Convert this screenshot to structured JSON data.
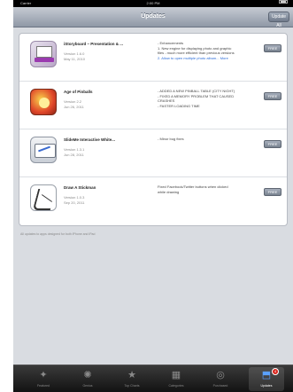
{
  "status_bar": {
    "carrier": "Carrier",
    "time": "2:00 PM",
    "battery": ""
  },
  "nav": {
    "title": "Updates",
    "right_button": "Update All"
  },
  "updates": [
    {
      "name": "iStoryboard – Presentation & ...",
      "version": "Version 1.6.0",
      "date": "May 11, 2010",
      "notes": [
        "- Enhancements",
        "1. New engine for displaying photo and graphic",
        "files - much more efficient than previous versions",
        "2. Allow to open multiple photo album...  More"
      ],
      "button": "FREE",
      "icon": "presentation-icon"
    },
    {
      "name": "Age of Pinballs",
      "version": "Version 2.2",
      "date": "Jun 26, 2011",
      "notes": [
        "- ADDED A NEW PINBALL TABLE (CITY NIGHT)",
        "- FIXED A MEMORY PROBLEM THAT CAUSED",
        "CRASHES",
        "- FASTER LOADING TIME"
      ],
      "button": "FREE",
      "icon": "pinball-icon"
    },
    {
      "name": "SlideMe Interactive White...",
      "version": "Version 1.3.1",
      "date": "Jun 28, 2011",
      "notes": [
        "- Minor bug fixes"
      ],
      "button": "FREE",
      "icon": "whiteboard-icon"
    },
    {
      "name": "Draw A Stickman",
      "version": "Version 1.0.3",
      "date": "Sep 20, 2011",
      "notes": [
        "Fixed Facebook/Twitter buttons when clicked",
        "while drawing"
      ],
      "button": "FREE",
      "icon": "stickman-icon"
    }
  ],
  "footer_note": "All updates to apps designed for both iPhone and iPad",
  "tabs": [
    {
      "label": "Featured",
      "icon": "featured-icon",
      "glyph": "✦",
      "active": false
    },
    {
      "label": "Genius",
      "icon": "genius-icon",
      "glyph": "✺",
      "active": false
    },
    {
      "label": "Top Charts",
      "icon": "star-icon",
      "glyph": "★",
      "active": false
    },
    {
      "label": "Categories",
      "icon": "categories-icon",
      "glyph": "▦",
      "active": false
    },
    {
      "label": "Purchased",
      "icon": "purchased-icon",
      "glyph": "◎",
      "active": false
    },
    {
      "label": "Updates",
      "icon": "updates-icon",
      "glyph": "⬒",
      "active": true,
      "badge": "4"
    }
  ],
  "colors": {
    "nav_top": "#c6cbd3",
    "nav_bottom": "#8f98a6",
    "tab_active": "#5aa0ff",
    "badge": "#d9251d"
  }
}
